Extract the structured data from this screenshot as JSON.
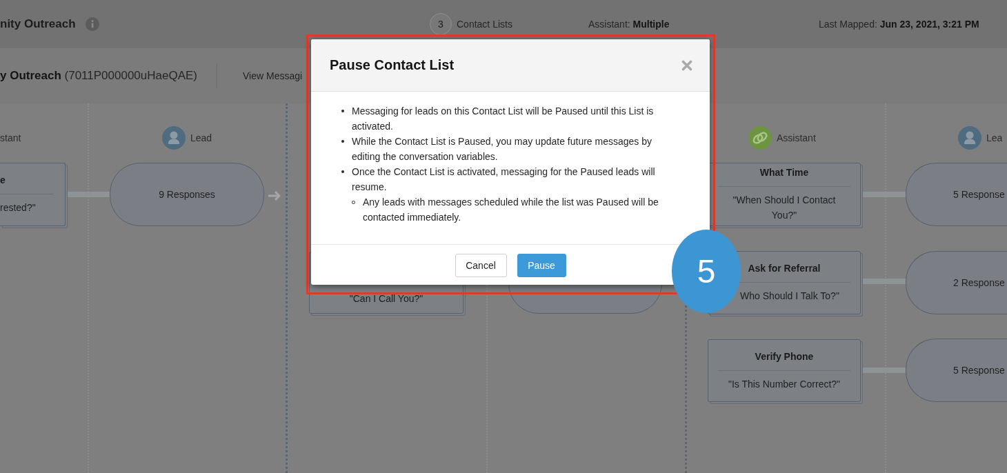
{
  "header": {
    "title": "nity Outreach",
    "contact_list_count": "3",
    "contact_lists_label": "Contact Lists",
    "assistant": "Assistant: **Multiple**",
    "last_mapped": "Last Mapped: **Jun 23, 2021, 3:21 PM**"
  },
  "subheader": {
    "campaign": "**y Outreach** (7011P000000uHaeQAE)",
    "link": "View Messagi"
  },
  "canvas": {
    "column_headers": [
      {
        "label": "stant"
      },
      {
        "kind": "lead",
        "label": "Lead"
      },
      {
        "kind": "assistant",
        "label": "Assistant"
      },
      {
        "kind": "lead",
        "label": "Lea"
      }
    ],
    "nodes": [
      {
        "kind": "message",
        "title": "e",
        "text": "rested?\""
      },
      {
        "kind": "responses",
        "text": "9 Responses"
      },
      {
        "kind": "message",
        "text": "\"Can I Call You?\""
      },
      {
        "kind": "responses"
      },
      {
        "kind": "message",
        "title": "What Time",
        "text": "\"When Should I Contact You?\""
      },
      {
        "kind": "message",
        "title": "Ask for Referral",
        "text": "Who Should I Talk To?\""
      },
      {
        "kind": "message",
        "title": "Verify Phone",
        "text": "\"Is This Number Correct?\""
      },
      {
        "kind": "responses",
        "text": "5 Response"
      },
      {
        "kind": "responses",
        "text": "2 Response"
      },
      {
        "kind": "responses",
        "text": "5 Response"
      }
    ]
  },
  "modal": {
    "title": "Pause Contact List",
    "items": [
      {
        "text": "Messaging for leads on this Contact List will be Paused until this List is activated."
      },
      {
        "text": "While the Contact List is Paused, you may update future messages by editing the conversation variables."
      },
      {
        "text": "Once the Contact List is activated, messaging for the Paused leads will resume.",
        "children": [
          {
            "text": "Any leads with messages scheduled while the list was Paused will be contacted immediately."
          }
        ]
      }
    ],
    "buttons": [
      {
        "label": "Cancel",
        "kind": "secondary"
      },
      {
        "label": "Pause",
        "kind": "primary"
      }
    ]
  },
  "step_badge": "5"
}
